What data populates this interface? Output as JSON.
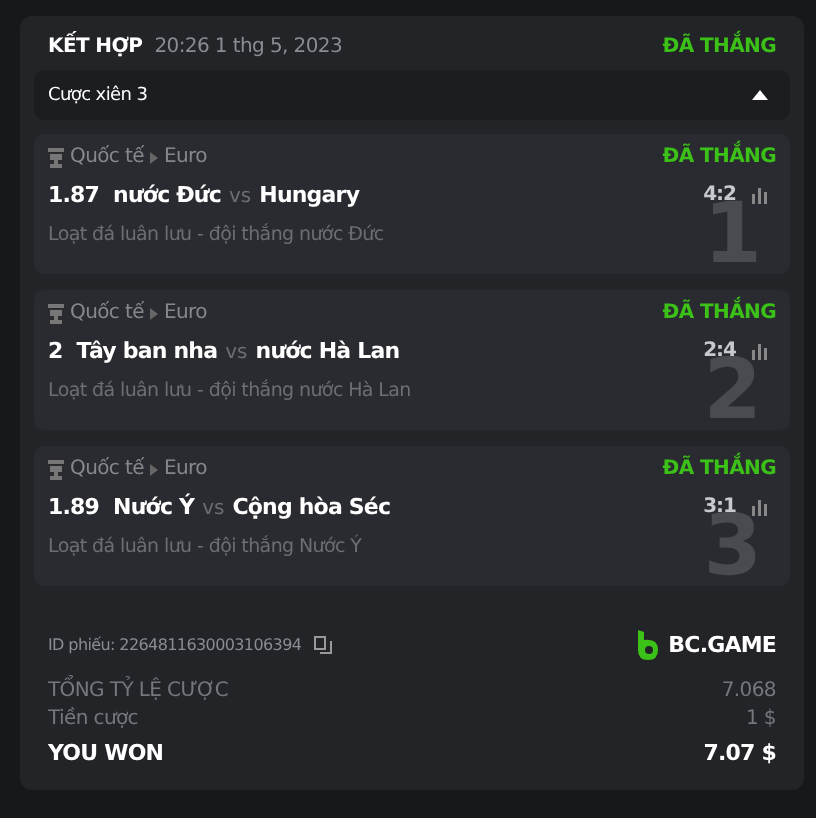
{
  "header": {
    "title": "KẾT HỢP",
    "datetime": "20:26 1 thg 5, 2023",
    "status": "ĐÃ THẮNG"
  },
  "group": {
    "label": "Cược xiên 3",
    "expanded": true
  },
  "legs": [
    {
      "number": "1",
      "category": "Quốc tế",
      "league": "Euro",
      "status": "ĐÃ THẮNG",
      "odds": "1.87",
      "home": "nước Đức",
      "vs": "vs",
      "away": "Hungary",
      "score": "4:2",
      "market": "Loạt đá luân lưu - đội thắng nước Đức"
    },
    {
      "number": "2",
      "category": "Quốc tế",
      "league": "Euro",
      "status": "ĐÃ THẮNG",
      "odds": "2",
      "home": "Tây ban nha",
      "vs": "vs",
      "away": "nước Hà Lan",
      "score": "2:4",
      "market": "Loạt đá luân lưu - đội thắng nước Hà Lan"
    },
    {
      "number": "3",
      "category": "Quốc tế",
      "league": "Euro",
      "status": "ĐÃ THẮNG",
      "odds": "1.89",
      "home": "Nước Ý",
      "vs": "vs",
      "away": "Cộng hòa Séc",
      "score": "3:1",
      "market": "Loạt đá luân lưu - đội thắng Nước Ý"
    }
  ],
  "ticket": {
    "id": "ID phiếu: 2264811630003106394",
    "brand": "BC.GAME"
  },
  "summary": [
    {
      "label": "TỔNG TỶ LỆ CƯỢC",
      "value": "7.068",
      "kind": "normal"
    },
    {
      "label": "Tiền cược",
      "value": "1 $",
      "kind": "normal"
    },
    {
      "label": "YOU WON",
      "value": "7.07 $",
      "kind": "total"
    }
  ]
}
